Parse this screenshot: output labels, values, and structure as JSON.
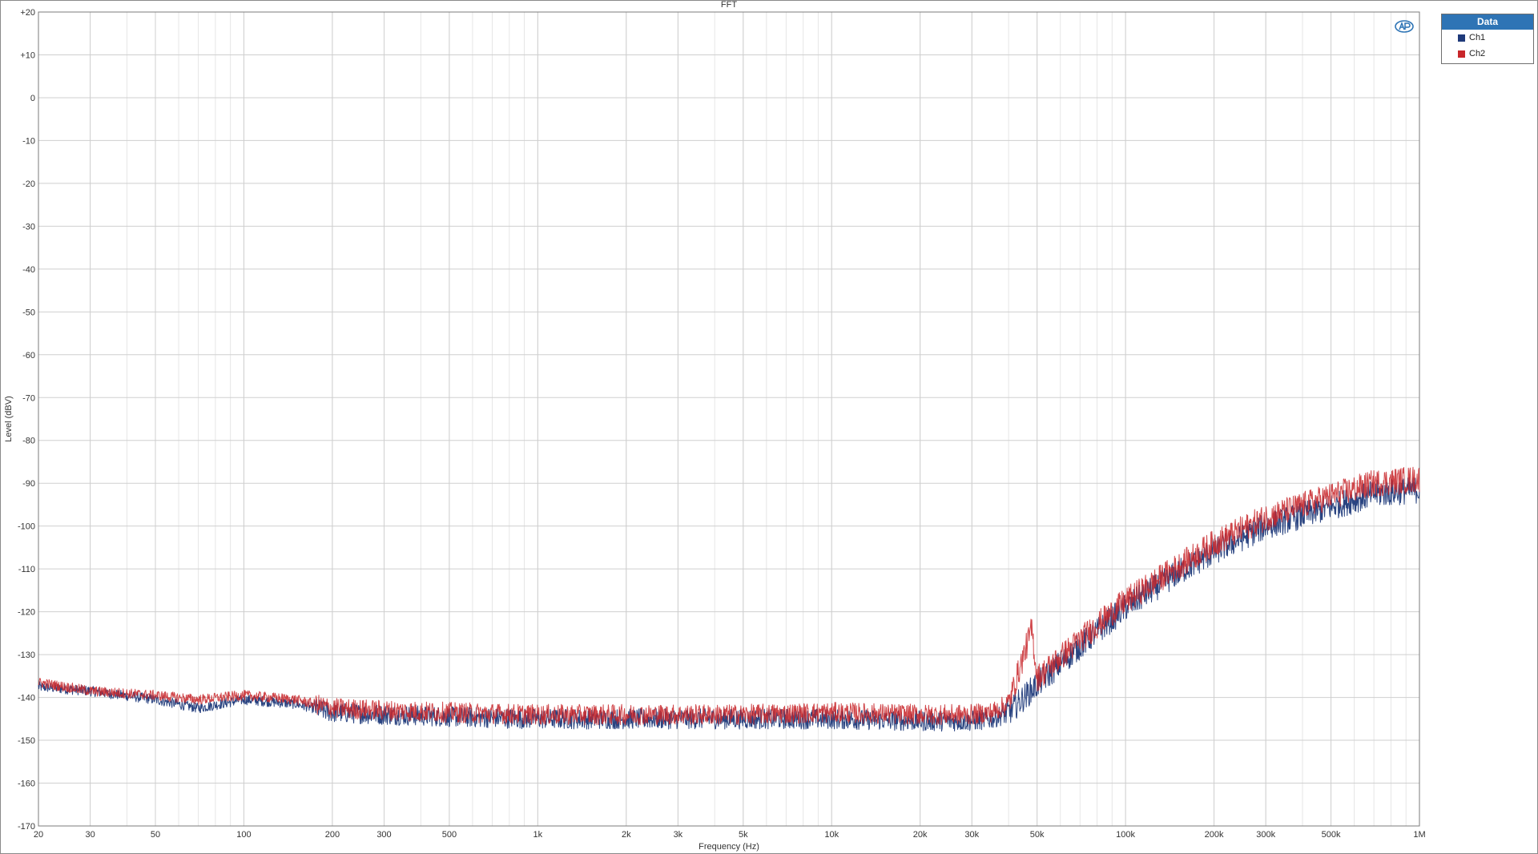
{
  "chart_data": {
    "type": "line",
    "title": "FFT",
    "xlabel": "Frequency (Hz)",
    "ylabel": "Level (dBV)",
    "x_scale": "log",
    "xlim": [
      20,
      1000000
    ],
    "ylim": [
      -170,
      20
    ],
    "grid": true,
    "legend_title": "Data",
    "legend_position": "top-right, outside plot",
    "x_tick_labels": [
      {
        "value": 20,
        "label": "20"
      },
      {
        "value": 30,
        "label": "30"
      },
      {
        "value": 50,
        "label": "50"
      },
      {
        "value": 100,
        "label": "100"
      },
      {
        "value": 200,
        "label": "200"
      },
      {
        "value": 300,
        "label": "300"
      },
      {
        "value": 500,
        "label": "500"
      },
      {
        "value": 1000,
        "label": "1k"
      },
      {
        "value": 2000,
        "label": "2k"
      },
      {
        "value": 3000,
        "label": "3k"
      },
      {
        "value": 5000,
        "label": "5k"
      },
      {
        "value": 10000,
        "label": "10k"
      },
      {
        "value": 20000,
        "label": "20k"
      },
      {
        "value": 30000,
        "label": "30k"
      },
      {
        "value": 50000,
        "label": "50k"
      },
      {
        "value": 100000,
        "label": "100k"
      },
      {
        "value": 200000,
        "label": "200k"
      },
      {
        "value": 300000,
        "label": "300k"
      },
      {
        "value": 500000,
        "label": "500k"
      },
      {
        "value": 1000000,
        "label": "1M"
      }
    ],
    "y_tick_labels": [
      {
        "value": 20,
        "label": "+20"
      },
      {
        "value": 10,
        "label": "+10"
      },
      {
        "value": 0,
        "label": "0"
      },
      {
        "value": -10,
        "label": "-10"
      },
      {
        "value": -20,
        "label": "-20"
      },
      {
        "value": -30,
        "label": "-30"
      },
      {
        "value": -40,
        "label": "-40"
      },
      {
        "value": -50,
        "label": "-50"
      },
      {
        "value": -60,
        "label": "-60"
      },
      {
        "value": -70,
        "label": "-70"
      },
      {
        "value": -80,
        "label": "-80"
      },
      {
        "value": -90,
        "label": "-90"
      },
      {
        "value": -100,
        "label": "-100"
      },
      {
        "value": -110,
        "label": "-110"
      },
      {
        "value": -120,
        "label": "-120"
      },
      {
        "value": -130,
        "label": "-130"
      },
      {
        "value": -140,
        "label": "-140"
      },
      {
        "value": -150,
        "label": "-150"
      },
      {
        "value": -160,
        "label": "-160"
      },
      {
        "value": -170,
        "label": "-170"
      }
    ],
    "series": [
      {
        "name": "Ch1",
        "color": "#1f3a7a",
        "x": [
          20,
          30,
          50,
          70,
          100,
          150,
          200,
          300,
          500,
          1000,
          2000,
          5000,
          10000,
          20000,
          30000,
          35000,
          40000,
          50000,
          70000,
          100000,
          150000,
          200000,
          300000,
          500000,
          700000,
          1000000
        ],
        "y": [
          -137.5,
          -138.5,
          -140.5,
          -142.5,
          -140.5,
          -141.5,
          -143.5,
          -144,
          -144.5,
          -145,
          -145,
          -145,
          -145,
          -145.5,
          -145.5,
          -145,
          -143.5,
          -137,
          -128,
          -119,
          -111,
          -106,
          -100,
          -95.5,
          -92.5,
          -91.5
        ]
      },
      {
        "name": "Ch2",
        "color": "#c8262a",
        "x": [
          20,
          30,
          50,
          70,
          100,
          150,
          200,
          300,
          500,
          1000,
          2000,
          5000,
          10000,
          20000,
          30000,
          35000,
          40000,
          48000,
          50000,
          70000,
          100000,
          150000,
          200000,
          300000,
          500000,
          700000,
          1000000
        ],
        "y": [
          -136.5,
          -138.5,
          -139.5,
          -140.5,
          -139.5,
          -140.5,
          -142.5,
          -143,
          -143.5,
          -144,
          -144,
          -144,
          -143.5,
          -144,
          -144,
          -143.5,
          -141.5,
          -124,
          -135.5,
          -126.5,
          -117.5,
          -109.5,
          -104,
          -98,
          -93,
          -90,
          -89
        ]
      }
    ]
  }
}
